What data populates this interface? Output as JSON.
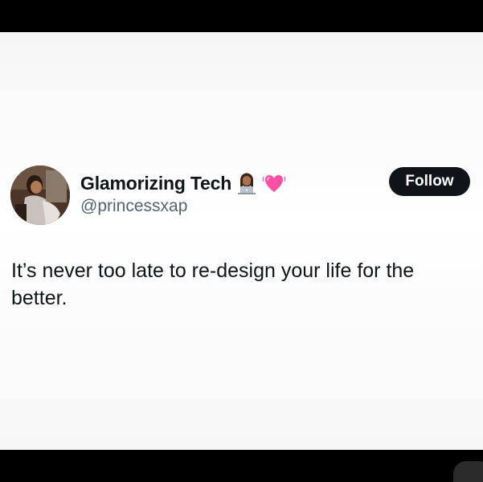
{
  "tweet": {
    "display_name": "Glamorizing Tech",
    "handle": "@princessxap",
    "follow_label": "Follow",
    "text": "It’s never too late to re-design your life for the better.",
    "badges": [
      "woman-technologist-emoji",
      "beating-heart-emoji"
    ]
  },
  "colors": {
    "card_background": "#ffffff",
    "text_primary": "#0f1419",
    "text_secondary": "#536471",
    "follow_button_bg": "#0f1419",
    "follow_button_text": "#ffffff",
    "frame_background": "#000000",
    "heart": "#ff4fa3"
  }
}
